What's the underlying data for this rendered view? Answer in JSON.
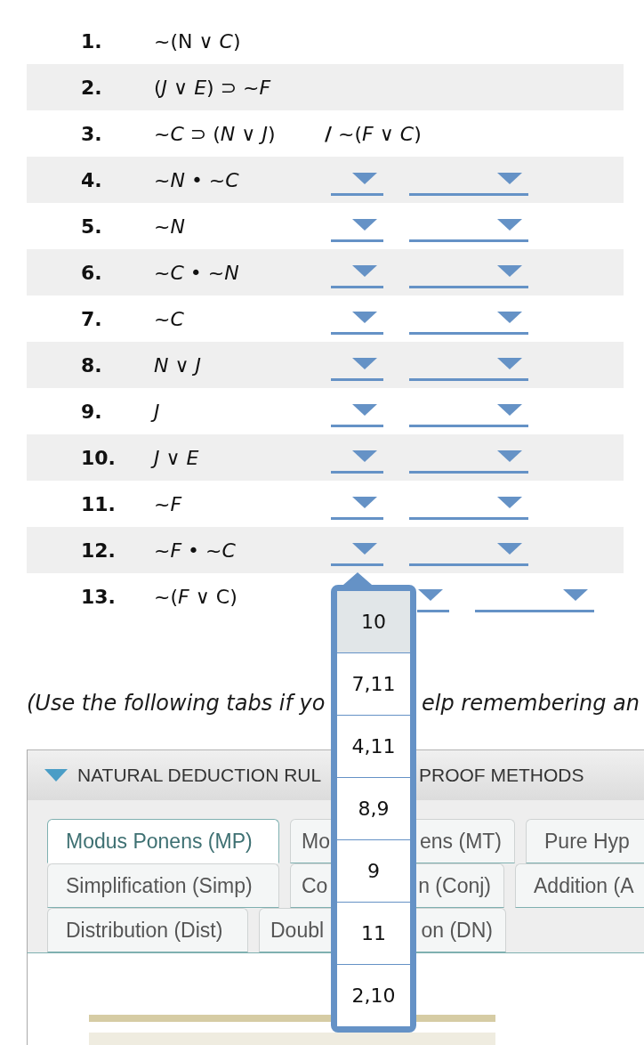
{
  "proof": {
    "lines": [
      {
        "number": "1.",
        "kind": "premise",
        "formula": "~(N ∨ *C*)"
      },
      {
        "number": "2.",
        "kind": "premise",
        "formula": "(*J* ∨ *E*) ⊃ ~*F*"
      },
      {
        "number": "3.",
        "kind": "premise",
        "formula": "~*C* ⊃ (*N* ∨ *J*)",
        "conclusion": "**/** ~(*F* ∨ *C*)"
      },
      {
        "number": "4.",
        "kind": "step",
        "formula": "~*N* • ~*C*",
        "line_select_open": false
      },
      {
        "number": "5.",
        "kind": "step",
        "formula": "~*N*",
        "line_select_open": false
      },
      {
        "number": "6.",
        "kind": "step",
        "formula": "~*C* • ~*N*",
        "line_select_open": false
      },
      {
        "number": "7.",
        "kind": "step",
        "formula": "~*C*",
        "line_select_open": false
      },
      {
        "number": "8.",
        "kind": "step",
        "formula": "*N* ∨ *J*",
        "line_select_open": false
      },
      {
        "number": "9.",
        "kind": "step",
        "formula": "*J*",
        "line_select_open": false
      },
      {
        "number": "10.",
        "kind": "step",
        "formula": "*J* ∨ *E*",
        "line_select_open": false
      },
      {
        "number": "11.",
        "kind": "step",
        "formula": "~*F*",
        "line_select_open": false
      },
      {
        "number": "12.",
        "kind": "step",
        "formula": "~*F* • ~*C*",
        "line_select_open": false
      },
      {
        "number": "13.",
        "kind": "step",
        "formula": "~(*F* ∨ C)",
        "line_select_open": true,
        "line_options": [
          {
            "label": "10",
            "selected": true
          },
          {
            "label": "7,11",
            "selected": false
          },
          {
            "label": "4,11",
            "selected": false
          },
          {
            "label": "8,9",
            "selected": false
          },
          {
            "label": "9",
            "selected": false
          },
          {
            "label": "11",
            "selected": false
          },
          {
            "label": "2,10",
            "selected": false
          }
        ]
      }
    ]
  },
  "note": {
    "visible_parts": [
      "(Use the following tabs if yo",
      "elp remembering an"
    ]
  },
  "panel": {
    "expanded": true,
    "title_parts": [
      "NATURAL DEDUCTION RUL",
      "PROOF METHODS"
    ],
    "tab_rows": [
      [
        {
          "label": "Modus Ponens (MP)",
          "selected": true
        },
        {
          "label_parts": [
            "Mo",
            "ens (MT)"
          ],
          "selected": false
        },
        {
          "label": "Pure Hyp",
          "selected": false
        }
      ],
      [
        {
          "label": "Simplification (Simp)",
          "selected": false
        },
        {
          "label_parts": [
            "Co",
            "n (Conj)"
          ],
          "selected": false
        },
        {
          "label": "Addition (A",
          "selected": false
        }
      ],
      [
        {
          "label": "Distribution (Dist)",
          "selected": false
        },
        {
          "label_parts": [
            "Doubl",
            "on (DN)"
          ],
          "selected": false
        }
      ]
    ]
  }
}
